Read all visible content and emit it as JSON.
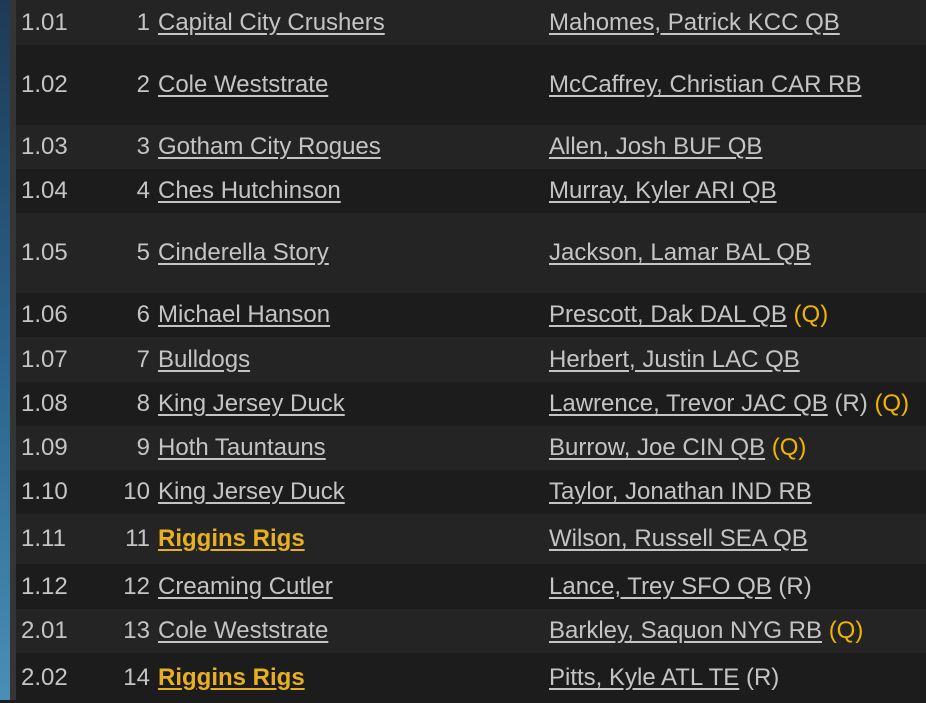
{
  "accent_color": "#e8b020",
  "rows": [
    {
      "pick": "1.01",
      "num": "1",
      "team": "Capital City Crushers",
      "mine": false,
      "player": "Mahomes, Patrick KCC QB",
      "rookie": "",
      "status": "",
      "h": 45
    },
    {
      "pick": "1.02",
      "num": "2",
      "team": "Cole Weststrate",
      "mine": false,
      "player": "McCaffrey, Christian CAR RB",
      "rookie": "",
      "status": "",
      "h": 80
    },
    {
      "pick": "1.03",
      "num": "3",
      "team": "Gotham City Rogues",
      "mine": false,
      "player": "Allen, Josh BUF QB",
      "rookie": "",
      "status": "",
      "h": 44
    },
    {
      "pick": "1.04",
      "num": "4",
      "team": "Ches Hutchinson",
      "mine": false,
      "player": "Murray, Kyler ARI QB",
      "rookie": "",
      "status": "",
      "h": 44
    },
    {
      "pick": "1.05",
      "num": "5",
      "team": "Cinderella Story",
      "mine": false,
      "player": "Jackson, Lamar BAL QB",
      "rookie": "",
      "status": "",
      "h": 80
    },
    {
      "pick": "1.06",
      "num": "6",
      "team": "Michael Hanson",
      "mine": false,
      "player": "Prescott, Dak DAL QB",
      "rookie": "",
      "status": "(Q)",
      "h": 44
    },
    {
      "pick": "1.07",
      "num": "7",
      "team": "Bulldogs",
      "mine": false,
      "player": "Herbert, Justin LAC QB",
      "rookie": "",
      "status": "",
      "h": 45
    },
    {
      "pick": "1.08",
      "num": "8",
      "team": "King Jersey Duck",
      "mine": false,
      "player": "Lawrence, Trevor JAC QB",
      "rookie": "(R)",
      "status": "(Q)",
      "h": 44
    },
    {
      "pick": "1.09",
      "num": "9",
      "team": "Hoth Tauntauns",
      "mine": false,
      "player": "Burrow, Joe CIN QB",
      "rookie": "",
      "status": "(Q)",
      "h": 44
    },
    {
      "pick": "1.10",
      "num": "10",
      "team": "King Jersey Duck",
      "mine": false,
      "player": "Taylor, Jonathan IND RB",
      "rookie": "",
      "status": "",
      "h": 44
    },
    {
      "pick": "1.11",
      "num": "11",
      "team": "Riggins Rigs",
      "mine": true,
      "player": "Wilson, Russell SEA QB",
      "rookie": "",
      "status": "",
      "h": 50
    },
    {
      "pick": "1.12",
      "num": "12",
      "team": "Creaming Cutler",
      "mine": false,
      "player": "Lance, Trey SFO QB",
      "rookie": "(R)",
      "status": "",
      "h": 45
    },
    {
      "pick": "2.01",
      "num": "13",
      "team": "Cole Weststrate",
      "mine": false,
      "player": "Barkley, Saquon NYG RB",
      "rookie": "",
      "status": "(Q)",
      "h": 44
    },
    {
      "pick": "2.02",
      "num": "14",
      "team": "Riggins Rigs",
      "mine": true,
      "player": "Pitts, Kyle ATL TE",
      "rookie": "(R)",
      "status": "",
      "h": 50
    }
  ]
}
